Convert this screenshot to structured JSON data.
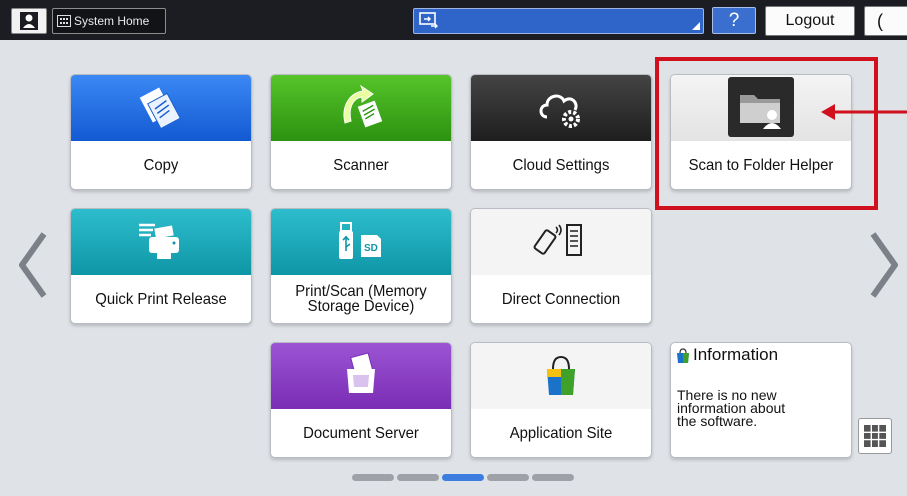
{
  "topbar": {
    "system_home_label": "System Home",
    "help_label": "?",
    "logout_label": "Logout",
    "night_label": "("
  },
  "apps": [
    {
      "id": "copy",
      "label": "Copy",
      "band_color": "#1f6fe6"
    },
    {
      "id": "scanner",
      "label": "Scanner",
      "band_color": "#3fa81c"
    },
    {
      "id": "cloud-settings",
      "label": "Cloud Settings",
      "band_color": "#2b2b2b"
    },
    {
      "id": "scan-to-folder-helper",
      "label": "Scan to Folder Helper",
      "band_color": "#ececec"
    },
    {
      "id": "quick-print-release",
      "label": "Quick Print Release",
      "band_color": "#18a6b6"
    },
    {
      "id": "print-scan-memory",
      "label_line1": "Print/Scan (Memory",
      "label_line2": "Storage Device)",
      "band_color": "#18a6b6"
    },
    {
      "id": "direct-connection",
      "label": "Direct Connection",
      "band_color": "#f4f4f4"
    },
    {
      "id": "document-server",
      "label": "Document Server",
      "band_color": "#8a3fc2"
    },
    {
      "id": "application-site",
      "label": "Application Site",
      "band_color": "#f4f4f4"
    }
  ],
  "information": {
    "title": "Information",
    "message_line1": "There is no new",
    "message_line2": "information about",
    "message_line3": "the software."
  },
  "highlight_color": "#d0101c",
  "page_indicator": {
    "count": 5,
    "active_index": 2
  }
}
